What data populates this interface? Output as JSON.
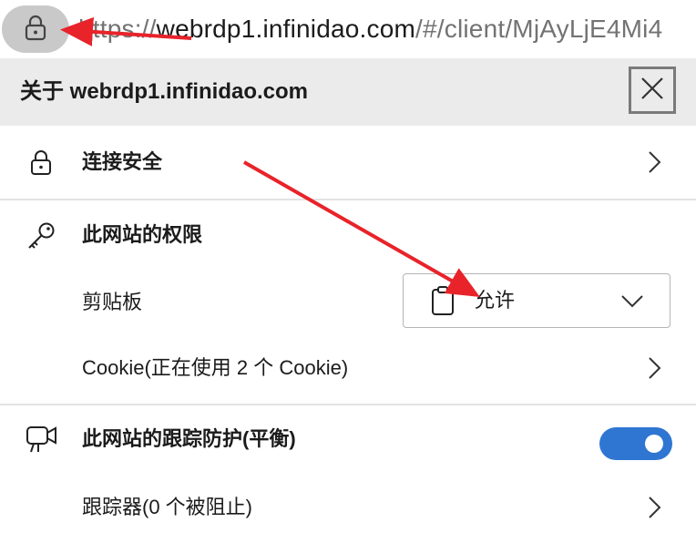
{
  "address_bar": {
    "url_scheme": "https://",
    "url_host": "webrdp1.infinidao.com",
    "url_path": "/#/client/MjAyLjE4Mi4",
    "lock_icon": "lock-icon"
  },
  "site_info_panel": {
    "title": "关于 webrdp1.infinidao.com",
    "close_icon": "close-icon",
    "connection": {
      "label": "连接安全",
      "icon": "lock-icon"
    },
    "permissions": {
      "heading": "此网站的权限",
      "icon": "key-icon",
      "clipboard": {
        "label": "剪贴板",
        "value": "允许",
        "icon": "clipboard-icon"
      },
      "cookies_label": "Cookie(正在使用 2 个 Cookie)"
    },
    "tracking": {
      "heading": "此网站的跟踪防护(平衡)",
      "icon": "tracking-icon",
      "enabled": true,
      "trackers_label": "跟踪器(0 个被阻止)"
    }
  },
  "colors": {
    "header_bg": "#ebebeb",
    "toggle_on": "#2f76d2",
    "annotation_arrow": "#e8232a"
  }
}
